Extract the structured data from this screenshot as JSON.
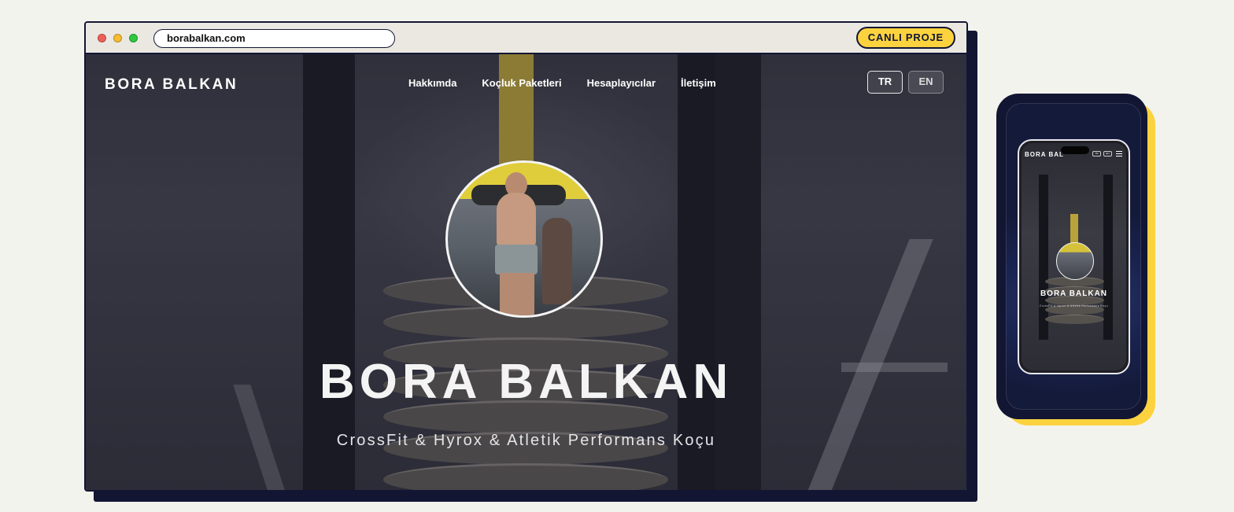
{
  "browser": {
    "url": "borabalkan.com",
    "live_button": "CANLI PROJE"
  },
  "site": {
    "logo": "BORA BALKAN",
    "nav": [
      {
        "label": "Hakkımda"
      },
      {
        "label": "Koçluk Paketleri"
      },
      {
        "label": "Hesaplayıcılar"
      },
      {
        "label": "İletişim"
      }
    ],
    "lang": {
      "tr": "TR",
      "en": "EN"
    },
    "hero": {
      "title": "BORA BALKAN",
      "subtitle": "CrossFit & Hyrox & Atletik Performans Koçu"
    }
  },
  "mobile": {
    "logo": "BORA BAL",
    "lang": {
      "tr": "TR",
      "en": "EN"
    },
    "hero_title": "BORA BALKAN",
    "hero_subtitle": "CrossFit & Hyrox & Atletik Performans Koçu"
  },
  "colors": {
    "page_bg": "#f3f3ee",
    "frame": "#121633",
    "accent": "#fcd33f"
  }
}
